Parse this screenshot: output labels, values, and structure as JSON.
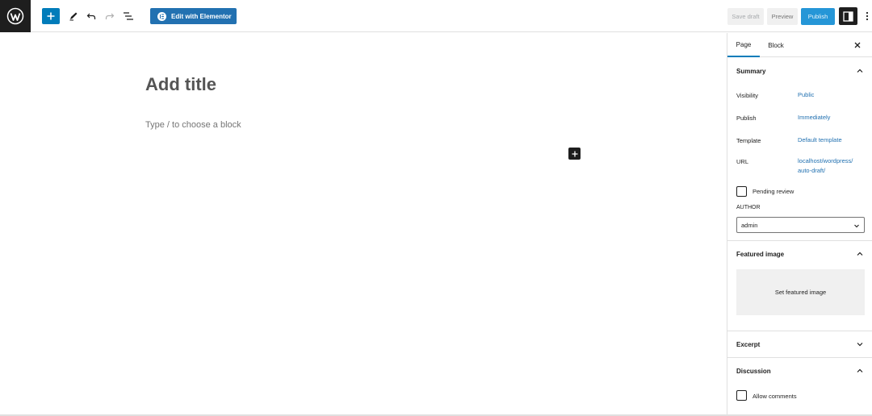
{
  "toolbar": {
    "elementor_label": "Edit with Elementor",
    "save_draft": "Save draft",
    "preview": "Preview",
    "publish": "Publish"
  },
  "editor": {
    "title_placeholder": "Add title",
    "block_placeholder": "Type / to choose a block"
  },
  "sidebar": {
    "tabs": [
      {
        "label": "Page",
        "active": true
      },
      {
        "label": "Block",
        "active": false
      }
    ],
    "summary": {
      "heading": "Summary",
      "rows": [
        {
          "label": "Visibility",
          "value": "Public"
        },
        {
          "label": "Publish",
          "value": "Immediately"
        },
        {
          "label": "Template",
          "value": "Default template"
        },
        {
          "label": "URL",
          "value_line1": "localhost/wordpress/",
          "value_line2": "auto-draft/"
        }
      ],
      "pending_review": "Pending review",
      "author_label": "AUTHOR",
      "author_value": "admin"
    },
    "featured_image": {
      "heading": "Featured image",
      "button": "Set featured image"
    },
    "excerpt": {
      "heading": "Excerpt"
    },
    "discussion": {
      "heading": "Discussion",
      "allow_comments": "Allow comments"
    }
  },
  "colors": {
    "accent": "#007cba",
    "elementor": "#2271b1",
    "publish": "#2596d7",
    "dark": "#1e1e1e"
  }
}
